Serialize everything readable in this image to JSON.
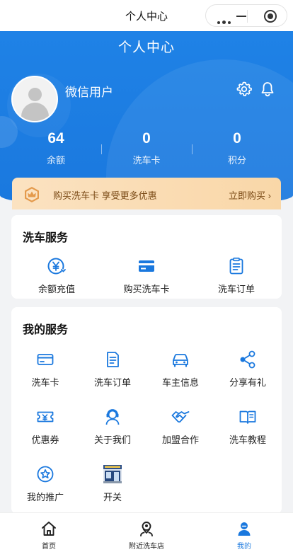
{
  "system_bar": {
    "title": "个人中心"
  },
  "header": {
    "title": "个人中心",
    "username": "微信用户",
    "stats": [
      {
        "value": "64",
        "label": "余额"
      },
      {
        "value": "0",
        "label": "洗车卡"
      },
      {
        "value": "0",
        "label": "积分"
      }
    ]
  },
  "promo": {
    "text": "购买洗车卡 享受更多优惠",
    "action": "立即购买"
  },
  "wash_services": {
    "title": "洗车服务",
    "items": [
      {
        "label": "余额充值",
        "icon": "yen-recharge-icon"
      },
      {
        "label": "购买洗车卡",
        "icon": "card-icon"
      },
      {
        "label": "洗车订单",
        "icon": "clipboard-icon"
      }
    ]
  },
  "my_services": {
    "title": "我的服务",
    "items": [
      {
        "label": "洗车卡",
        "icon": "card-outline-icon"
      },
      {
        "label": "洗车订单",
        "icon": "order-list-icon"
      },
      {
        "label": "车主信息",
        "icon": "car-icon"
      },
      {
        "label": "分享有礼",
        "icon": "share-icon"
      },
      {
        "label": "优惠券",
        "icon": "coupon-icon"
      },
      {
        "label": "关于我们",
        "icon": "service-person-icon"
      },
      {
        "label": "加盟合作",
        "icon": "handshake-icon"
      },
      {
        "label": "洗车教程",
        "icon": "book-icon"
      },
      {
        "label": "我的推广",
        "icon": "star-badge-icon"
      },
      {
        "label": "开关",
        "icon": "shop-image-icon"
      }
    ]
  },
  "tabbar": {
    "items": [
      {
        "label": "首页",
        "icon": "home-icon"
      },
      {
        "label": "附近洗车店",
        "icon": "location-person-icon"
      },
      {
        "label": "我的",
        "icon": "profile-icon"
      }
    ],
    "active": "我的"
  },
  "colors": {
    "primary": "#1a78de",
    "promo_text": "#7a4a16",
    "promo_bg": "#fbe2c1"
  }
}
